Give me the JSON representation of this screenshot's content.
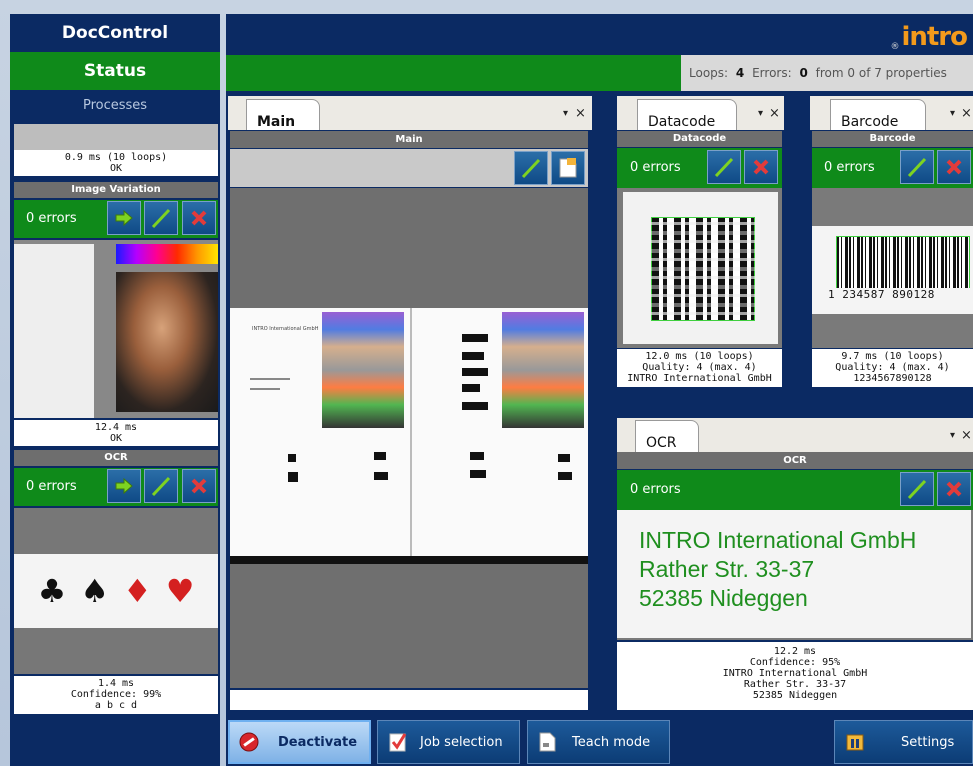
{
  "app": {
    "title": "DocControl",
    "status_label": "Status",
    "logo_text": "intro",
    "logo_mark": "®"
  },
  "topbar": {
    "loops_label": "Loops:",
    "loops_value": "4",
    "errors_label": "Errors:",
    "errors_value": "0",
    "from_text": "from 0 of 7 properties"
  },
  "sidebar": {
    "processes_label": "Processes",
    "first_process": {
      "line1": "0.9 ms (10 loops)",
      "line2": "OK"
    },
    "image_variation": {
      "title": "Image Variation",
      "errors": "0 errors",
      "line1": "12.4 ms",
      "line2": "OK"
    },
    "ocr": {
      "title": "OCR",
      "errors": "0 errors",
      "line1": "1.4 ms",
      "line2": "Confidence: 99%",
      "line3": "a b c d"
    }
  },
  "main_panel": {
    "tab_label": "Main",
    "header": "Main",
    "doc_title": "INTRO International GmbH",
    "colors": {
      "accent": "#0f8a1a",
      "navy": "#0b2a63"
    }
  },
  "datacode_panel": {
    "tab_label": "Datacode",
    "header": "Datacode",
    "errors": "0 errors",
    "line1": "12.0 ms (10 loops)",
    "line2": "Quality: 4 (max. 4)",
    "line3": "INTRO International GmbH"
  },
  "barcode_panel": {
    "tab_label": "Barcode",
    "header": "Barcode",
    "errors": "0 errors",
    "barcode_digits": "1 234587 890128",
    "line1": "9.7 ms (10 loops)",
    "line2": "Quality: 4 (max. 4)",
    "line3": "1234567890128"
  },
  "ocr_panel": {
    "tab_label": "OCR",
    "header": "OCR",
    "errors": "0 errors",
    "text_line1": "INTRO International GmbH",
    "text_line2": "Rather Str. 33-37",
    "text_line3": "52385 Nideggen",
    "line1": "12.2 ms",
    "line2": "Confidence: 95%",
    "line3": "INTRO International GmbH",
    "line4": "Rather Str. 33-37",
    "line5": "52385 Nideggen"
  },
  "tab_controls": {
    "dropdown": "▾",
    "close": "×"
  },
  "bottom_bar": {
    "deactivate": "Deactivate",
    "job_selection": "Job selection",
    "teach_mode": "Teach mode",
    "settings": "Settings"
  }
}
